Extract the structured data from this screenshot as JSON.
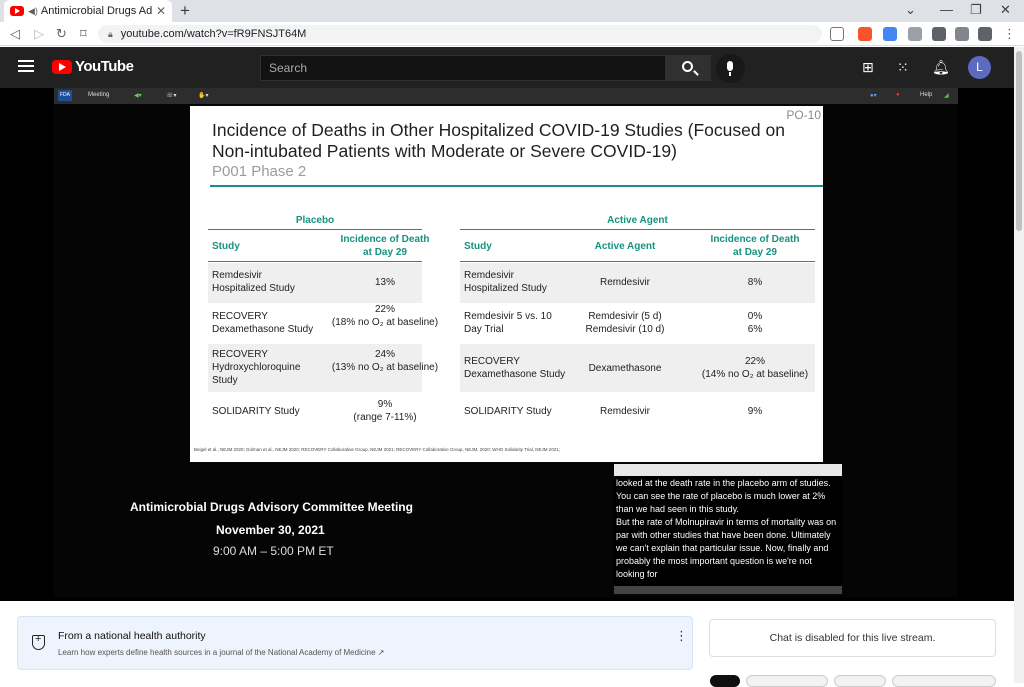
{
  "browser": {
    "tab_title": "Antimicrobial Drugs Advisory C",
    "new_tab": "+",
    "url": "youtube.com/watch?v=fR9FNSJT64M"
  },
  "youtube": {
    "logo_text": "YouTube",
    "search_placeholder": "Search",
    "avatar_letter": "L"
  },
  "meeting_toolbar": {
    "fda": "FDA",
    "meeting": "Meeting",
    "help": "Help"
  },
  "slide": {
    "number": "PO-10",
    "title": "Incidence of Deaths in Other Hospitalized COVID-19 Studies (Focused on Non-intubated Patients with Moderate or Severe COVID-19)",
    "subtitle": "P001 Phase 2",
    "placebo_group": "Placebo",
    "active_group": "Active Agent",
    "headers": {
      "study": "Study",
      "incidence": "Incidence of Death\nat Day 29",
      "active_agent": "Active Agent"
    },
    "placebo_rows": [
      {
        "study": "Remdesivir\nHospitalized Study",
        "incidence": "13%"
      },
      {
        "study": "RECOVERY\nDexamethasone Study",
        "incidence": "22%\n(18% no O₂ at baseline)"
      },
      {
        "study": "RECOVERY\nHydroxychloroquine\nStudy",
        "incidence": "24%\n(13% no O₂ at baseline)"
      },
      {
        "study": "SOLIDARITY Study",
        "incidence": "9%\n(range 7-11%)"
      }
    ],
    "active_rows": [
      {
        "study": "Remdesivir\nHospitalized Study",
        "agent": "Remdesivir",
        "incidence": "8%"
      },
      {
        "study": "Remdesivir 5 vs. 10\nDay Trial",
        "agent": "Remdesivir (5 d)\nRemdesivir (10 d)",
        "incidence": "0%\n6%"
      },
      {
        "study": "RECOVERY\nDexamethasone Study",
        "agent": "Dexamethasone",
        "incidence": "22%\n(14% no O₂ at baseline)"
      },
      {
        "study": "SOLIDARITY Study",
        "agent": "Remdesivir",
        "incidence": "9%"
      }
    ],
    "references": "Beigel et al., NEJM 2020; Golman et al., NEJM 2020; RECOVERY Collaborative Group, NEJM 2021; RECOVERY Collaborative Group, NEJM, 2020; WHO Solidarity Trial, NEJM 2021;"
  },
  "meeting_info": {
    "name": "Antimicrobial Drugs Advisory Committee Meeting",
    "date": "November  30, 2021",
    "time": "9:00 AM – 5:00 PM ET"
  },
  "caption": {
    "text": "looked at the death rate in the placebo arm of studies. You can see the rate of placebo is much lower at 2% than we had seen in this study.\n    But the rate of Molnupiravir in terms of mortality was on par with other studies that have been done. Ultimately we can't explain that particular issue. Now, finally and probably the most important question is we're not looking for"
  },
  "info_panel": {
    "title": "From a national health authority",
    "subtitle": "Learn how experts define health sources in a journal of the National Academy of Medicine ↗"
  },
  "chat": {
    "message": "Chat is disabled for this live stream."
  },
  "colors": {
    "accent_teal": "#17927f",
    "youtube_red": "#ff0000",
    "header_dark": "#212121"
  }
}
